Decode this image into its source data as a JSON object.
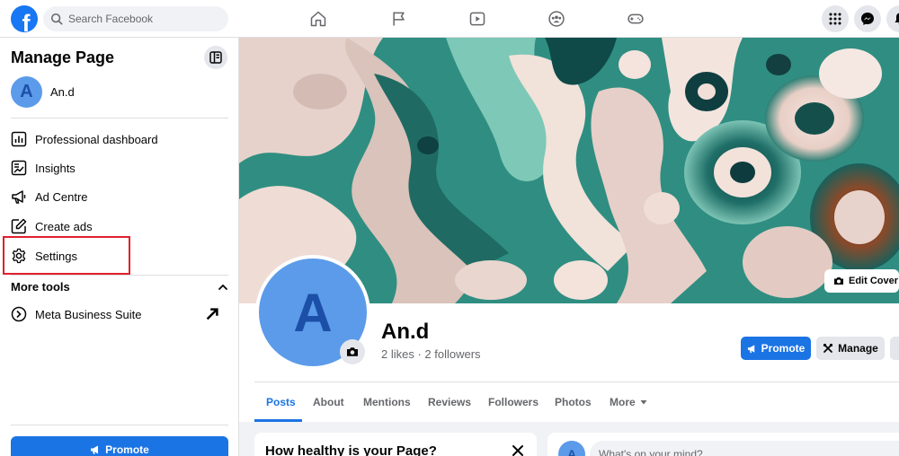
{
  "topbar": {
    "logo": "f",
    "search_placeholder": "Search Facebook",
    "nav_icons": [
      "home-icon",
      "flag-icon",
      "video-icon",
      "groups-icon",
      "gaming-icon"
    ],
    "right_icons": [
      "menu-grid-icon",
      "messenger-icon",
      "notifications-icon"
    ]
  },
  "sidebar": {
    "title": "Manage Page",
    "page": {
      "initial": "A",
      "name": "An.d"
    },
    "items": [
      {
        "label": "Professional dashboard",
        "icon": "dashboard-icon"
      },
      {
        "label": "Insights",
        "icon": "insights-icon"
      },
      {
        "label": "Ad Centre",
        "icon": "megaphone-icon"
      },
      {
        "label": "Create ads",
        "icon": "edit-icon"
      },
      {
        "label": "Settings",
        "icon": "gear-icon"
      }
    ],
    "more_tools_label": "More tools",
    "tools": [
      {
        "label": "Meta Business Suite",
        "icon": "meta-business-icon"
      }
    ],
    "promote_label": "Promote"
  },
  "cover": {
    "edit_label": "Edit Cover P"
  },
  "profile": {
    "initial": "A",
    "name": "An.d",
    "stats": "2 likes · 2 followers",
    "promote_label": "Promote",
    "manage_label": "Manage"
  },
  "tabs": [
    {
      "label": "Posts",
      "active": true
    },
    {
      "label": "About"
    },
    {
      "label": "Mentions"
    },
    {
      "label": "Reviews"
    },
    {
      "label": "Followers"
    },
    {
      "label": "Photos"
    },
    {
      "label": "More"
    }
  ],
  "health_card": {
    "title": "How healthy is your Page?"
  },
  "composer": {
    "initial": "A",
    "placeholder": "What's on your mind?"
  },
  "colors": {
    "brand": "#1877f2",
    "primary_button": "#1b74e4",
    "highlight": "#e1202b",
    "avatar": "#5b9bea"
  }
}
